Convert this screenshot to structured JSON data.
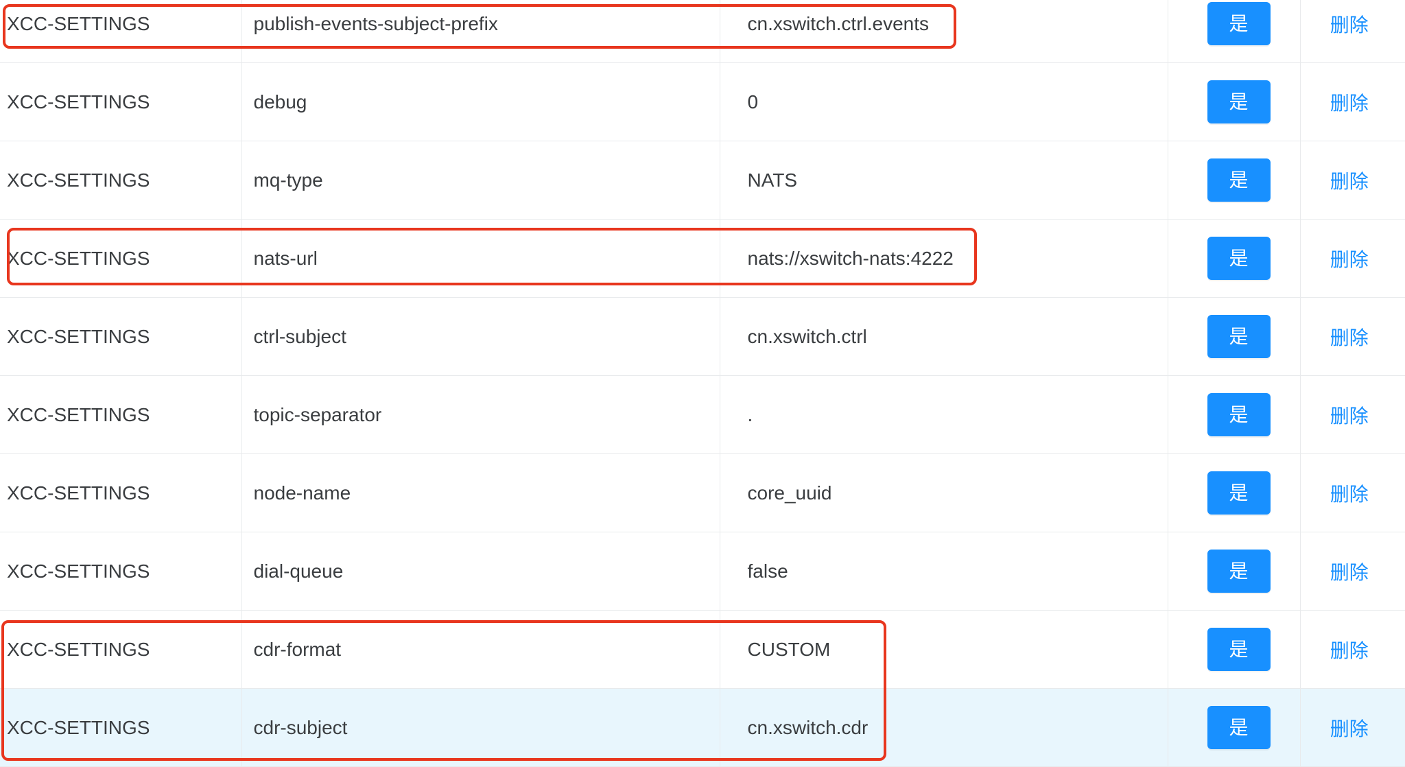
{
  "table": {
    "rows": [
      {
        "category": "XCC-SETTINGS",
        "key": "publish-events-subject-prefix",
        "value": "cn.xswitch.ctrl.events",
        "enabled_label": "是",
        "action_label": "删除",
        "annotated": true
      },
      {
        "category": "XCC-SETTINGS",
        "key": "debug",
        "value": "0",
        "enabled_label": "是",
        "action_label": "删除",
        "annotated": false
      },
      {
        "category": "XCC-SETTINGS",
        "key": "mq-type",
        "value": "NATS",
        "enabled_label": "是",
        "action_label": "删除",
        "annotated": false
      },
      {
        "category": "XCC-SETTINGS",
        "key": "nats-url",
        "value": "nats://xswitch-nats:4222",
        "enabled_label": "是",
        "action_label": "删除",
        "annotated": true
      },
      {
        "category": "XCC-SETTINGS",
        "key": "ctrl-subject",
        "value": "cn.xswitch.ctrl",
        "enabled_label": "是",
        "action_label": "删除",
        "annotated": false
      },
      {
        "category": "XCC-SETTINGS",
        "key": "topic-separator",
        "value": ".",
        "enabled_label": "是",
        "action_label": "删除",
        "annotated": false
      },
      {
        "category": "XCC-SETTINGS",
        "key": "node-name",
        "value": "core_uuid",
        "enabled_label": "是",
        "action_label": "删除",
        "annotated": false
      },
      {
        "category": "XCC-SETTINGS",
        "key": "dial-queue",
        "value": "false",
        "enabled_label": "是",
        "action_label": "删除",
        "annotated": false
      },
      {
        "category": "XCC-SETTINGS",
        "key": "cdr-format",
        "value": "CUSTOM",
        "enabled_label": "是",
        "action_label": "删除",
        "annotated": true
      },
      {
        "category": "XCC-SETTINGS",
        "key": "cdr-subject",
        "value": "cn.xswitch.cdr",
        "enabled_label": "是",
        "action_label": "删除",
        "annotated": true,
        "hovered": true
      }
    ]
  },
  "colors": {
    "primary": "#1890ff",
    "annotation": "#e8361e",
    "row_hover": "#e8f6fd",
    "text": "#3a3d40",
    "border": "#e8eaec"
  }
}
